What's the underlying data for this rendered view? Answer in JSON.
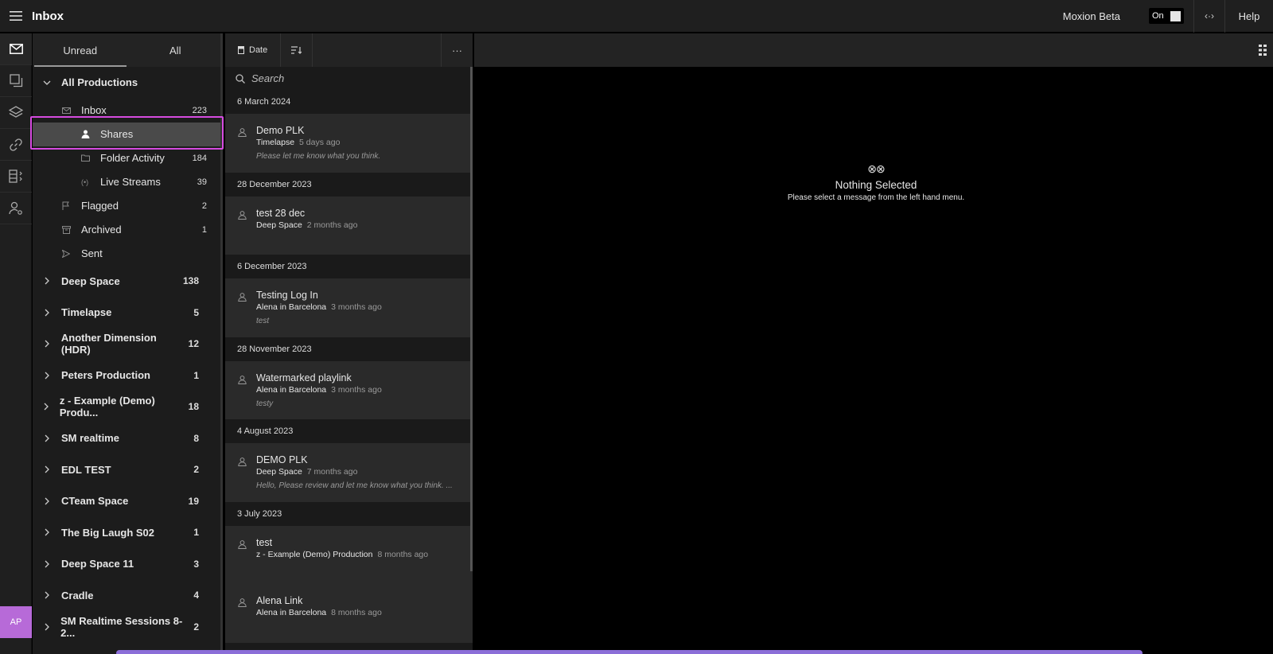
{
  "app": {
    "title": "Inbox",
    "beta_label": "Moxion Beta",
    "toggle_label": "On",
    "help_label": "Help",
    "user_initials": "AP"
  },
  "folder_tabs": [
    {
      "label": "Unread"
    },
    {
      "label": "All"
    }
  ],
  "all_productions": {
    "label": "All Productions",
    "inbox": {
      "label": "Inbox",
      "count": "223"
    },
    "inbox_children": [
      {
        "label": "Shares",
        "count": ""
      },
      {
        "label": "Folder Activity",
        "count": "184"
      },
      {
        "label": "Live Streams",
        "count": "39"
      }
    ],
    "others": [
      {
        "label": "Flagged",
        "count": "2"
      },
      {
        "label": "Archived",
        "count": "1"
      },
      {
        "label": "Sent",
        "count": ""
      }
    ]
  },
  "productions": [
    {
      "label": "Deep Space",
      "count": "138"
    },
    {
      "label": "Timelapse",
      "count": "5"
    },
    {
      "label": "Another Dimension (HDR)",
      "count": "12"
    },
    {
      "label": "Peters Production",
      "count": "1"
    },
    {
      "label": "z - Example (Demo) Produ...",
      "count": "18"
    },
    {
      "label": "SM realtime",
      "count": "8"
    },
    {
      "label": "EDL TEST",
      "count": "2"
    },
    {
      "label": "CTeam Space",
      "count": "19"
    },
    {
      "label": "The Big Laugh S02",
      "count": "1"
    },
    {
      "label": "Deep Space 11",
      "count": "3"
    },
    {
      "label": "Cradle",
      "count": "4"
    },
    {
      "label": "SM Realtime Sessions 8-2...",
      "count": "2"
    }
  ],
  "list_toolbar": {
    "sort_label": "Date",
    "more_label": "···"
  },
  "search": {
    "placeholder": "Search"
  },
  "groups": [
    {
      "date": "6 March 2024",
      "messages": [
        {
          "title": "Demo PLK",
          "production": "Timelapse",
          "ago": "5 days ago",
          "body": "Please let me know what you think."
        }
      ]
    },
    {
      "date": "28 December 2023",
      "messages": [
        {
          "title": "test 28 dec",
          "production": "Deep Space",
          "ago": "2 months ago",
          "body": ""
        }
      ]
    },
    {
      "date": "6 December 2023",
      "messages": [
        {
          "title": "Testing Log In",
          "production": "Alena in Barcelona",
          "ago": "3 months ago",
          "body": "test"
        }
      ]
    },
    {
      "date": "28 November 2023",
      "messages": [
        {
          "title": "Watermarked playlink",
          "production": "Alena in Barcelona",
          "ago": "3 months ago",
          "body": "testy"
        }
      ]
    },
    {
      "date": "4 August 2023",
      "messages": [
        {
          "title": "DEMO PLK",
          "production": "Deep Space",
          "ago": "7 months ago",
          "body": "Hello, Please review and let me know what you think. ..."
        }
      ]
    },
    {
      "date": "3 July 2023",
      "messages": [
        {
          "title": "test",
          "production": "z - Example (Demo) Production",
          "ago": "8 months ago",
          "body": ""
        },
        {
          "title": "Alena Link",
          "production": "Alena in Barcelona",
          "ago": "8 months ago",
          "body": ""
        }
      ]
    }
  ],
  "empty_state": {
    "icon": "⊗⊗",
    "title": "Nothing Selected",
    "subtitle": "Please select a message from the left hand menu."
  },
  "colors": {
    "accent": "#d64be0",
    "avatar": "#b76ad8",
    "selected_row": "#4a4a4a"
  }
}
